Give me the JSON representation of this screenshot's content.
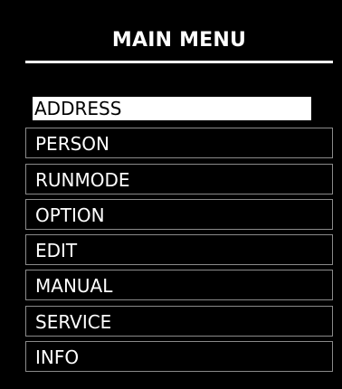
{
  "header": {
    "title": "MAIN MENU"
  },
  "menu": {
    "items": [
      {
        "label": "ADDRESS",
        "selected": true
      },
      {
        "label": "PERSON",
        "selected": false
      },
      {
        "label": "RUNMODE",
        "selected": false
      },
      {
        "label": "OPTION",
        "selected": false
      },
      {
        "label": "EDIT",
        "selected": false
      },
      {
        "label": "MANUAL",
        "selected": false
      },
      {
        "label": "SERVICE",
        "selected": false
      },
      {
        "label": "INFO",
        "selected": false
      }
    ]
  },
  "colors": {
    "background": "#000000",
    "foreground": "#ffffff",
    "border": "#8a8a8a",
    "selected_background": "#ffffff",
    "selected_text": "#000000"
  }
}
